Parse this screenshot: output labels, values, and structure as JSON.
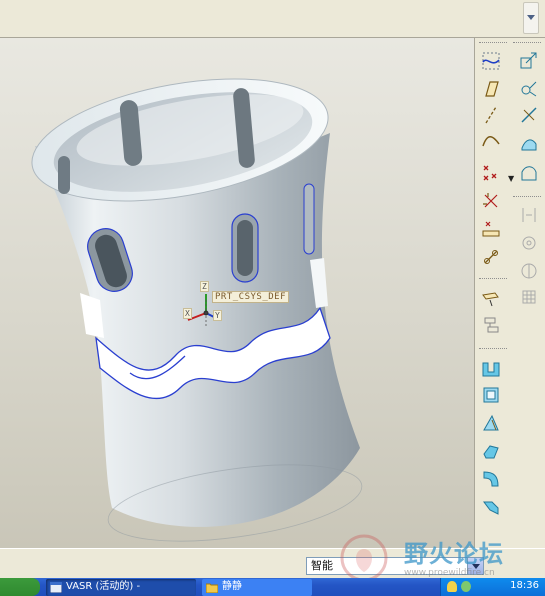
{
  "viewport": {
    "csys_label": "PRT_CSYS_DEF",
    "axis_x": "X",
    "axis_y": "Y",
    "axis_z": "Z",
    "background_top": "#e9e8e1",
    "background_bottom": "#c9c6b8",
    "model_color": "#c9d2d9",
    "edge_highlight_color": "#2a3fd0"
  },
  "toolbar": {
    "left_column_icons": [
      "sketch-curve-icon",
      "datum-plane-icon",
      "datum-axis-icon",
      "curve-icon",
      "datum-point-icon",
      "datum-point-offset-icon",
      "datum-point-field-icon",
      "coordinate-system-icon",
      "analysis-icon",
      "layer-icon",
      "extrude-icon",
      "shell-icon",
      "draft-icon",
      "rib-icon",
      "round-icon",
      "chamfer-icon"
    ],
    "right_column_icons": [
      "copy-icon",
      "mirror-tool-icon",
      "trim-icon",
      "surface-icon",
      "offset-icon",
      "merge-icon",
      "pattern-icon",
      "transform-icon",
      "grid-icon"
    ]
  },
  "status": {
    "filter_value": "智能"
  },
  "watermark": {
    "text": "野火论坛",
    "url": "www.proewildfire.cn"
  },
  "taskbar": {
    "task_1_label": "VASR (活动的) -",
    "task_2_label": "静静",
    "clock": "18:36"
  },
  "colors": {
    "accent": "#2455c5",
    "toolbar_bg": "#ece9d8"
  }
}
